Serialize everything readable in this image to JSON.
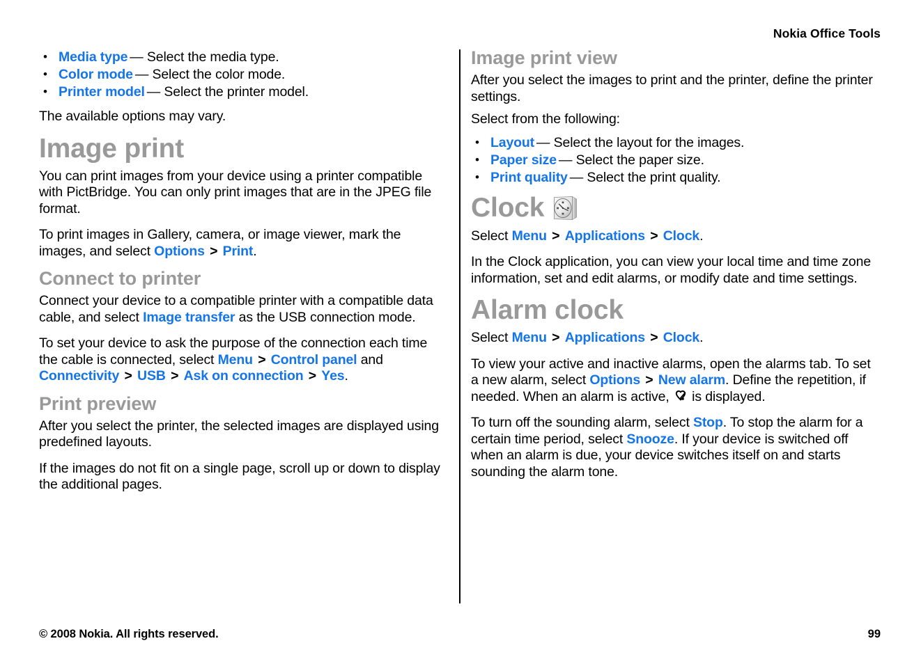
{
  "header": {
    "running_head": "Nokia Office Tools"
  },
  "footer": {
    "copyright": "© 2008 Nokia. All rights reserved.",
    "page_number": "99"
  },
  "colors": {
    "link": "#1575E8",
    "heading": "#999999",
    "text": "#000000"
  },
  "left_column": {
    "printer_settings_bullets": [
      {
        "term": "Media type",
        "dash": "—",
        "description": "Select the media type."
      },
      {
        "term": "Color mode",
        "dash": "—",
        "description": "Select the color mode."
      },
      {
        "term": "Printer model",
        "dash": "—",
        "description": "Select the printer model."
      }
    ],
    "options_note": "The available options may vary.",
    "image_print": {
      "heading": "Image print",
      "para_1": "You can print images from your device using a printer compatible with PictBridge. You can only print images that are in the JPEG file format.",
      "para_2_a": "To print images in Gallery, camera, or image viewer, mark the images, and select ",
      "para_2_ui_1": "Options",
      "para_2_gt": ">",
      "para_2_ui_2": "Print",
      "para_2_b": "."
    },
    "connect_to_printer": {
      "heading": "Connect to printer",
      "para_1_a": "Connect your device to a compatible printer with a compatible data cable, and select ",
      "para_1_ui_1": "Image transfer",
      "para_1_b": " as the USB connection mode.",
      "para_2_a": "To set your device to ask the purpose of the connection each time the cable is connected, select ",
      "para_2_ui_1": "Menu",
      "para_2_gt_1": ">",
      "para_2_ui_2": "Control panel",
      "para_2_b": " and ",
      "para_2_ui_3": "Connectivity",
      "para_2_gt_2": ">",
      "para_2_ui_4": "USB",
      "para_2_gt_3": ">",
      "para_2_ui_5": "Ask on connection",
      "para_2_gt_4": ">",
      "para_2_ui_6": "Yes",
      "para_2_c": "."
    },
    "print_preview": {
      "heading": "Print preview",
      "para_1": "After you select the printer, the selected images are displayed using predefined layouts.",
      "para_2": "If the images do not fit on a single page, scroll up or down to display the additional pages."
    }
  },
  "right_column": {
    "image_print_view": {
      "heading": "Image print view",
      "para_1": "After you select the images to print and the printer, define the printer settings.",
      "para_2": "Select from the following:",
      "bullets": [
        {
          "term": "Layout",
          "dash": "—",
          "description": "Select the layout for the images."
        },
        {
          "term": "Paper size",
          "dash": "—",
          "description": "Select the paper size."
        },
        {
          "term": "Print quality",
          "dash": "—",
          "description": "Select the print quality."
        }
      ]
    },
    "clock": {
      "heading": "Clock",
      "icon": "clock-icon",
      "path_a": "Select ",
      "path_ui_1": "Menu",
      "path_gt_1": ">",
      "path_ui_2": "Applications",
      "path_gt_2": ">",
      "path_ui_3": "Clock",
      "path_b": ".",
      "para_1": "In the Clock application, you can view your local time and time zone information, set and edit alarms, or modify date and time settings."
    },
    "alarm_clock": {
      "heading": "Alarm clock",
      "path_a": "Select ",
      "path_ui_1": "Menu",
      "path_gt_1": ">",
      "path_ui_2": "Applications",
      "path_gt_2": ">",
      "path_ui_3": "Clock",
      "path_b": ".",
      "para_1_a": "To view your active and inactive alarms, open the alarms tab. To set a new alarm, select ",
      "para_1_ui_1": "Options",
      "para_1_gt_1": ">",
      "para_1_ui_2": "New alarm",
      "para_1_b": ". Define the repetition, if needed. When an alarm is active, ",
      "para_1_icon": "alarm-active-icon",
      "para_1_c": " is displayed.",
      "para_2_a": "To turn off the sounding alarm, select ",
      "para_2_ui_1": "Stop",
      "para_2_b": ". To stop the alarm for a certain time period, select ",
      "para_2_ui_2": "Snooze",
      "para_2_c": ". If your device is switched off when an alarm is due, your device switches itself on and starts sounding the alarm tone."
    }
  }
}
